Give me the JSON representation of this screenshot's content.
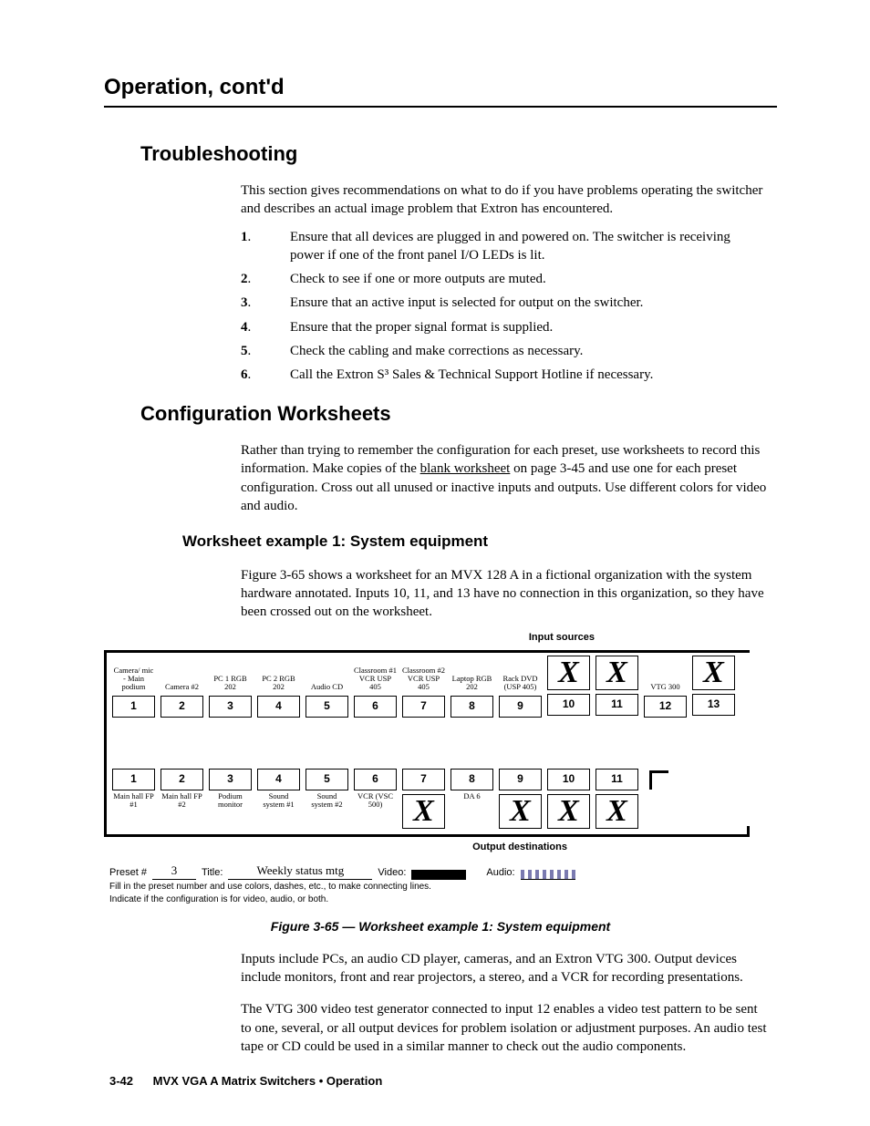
{
  "running_head": "Operation, cont'd",
  "sections": {
    "troubleshooting": {
      "title": "Troubleshooting",
      "intro": "This section gives recommendations on what to do if you have problems operating the switcher and describes an actual image problem that Extron has encountered.",
      "steps": [
        "Ensure that all devices are plugged in and powered on.  The switcher is receiving power if one of the front panel I/O LEDs is lit.",
        "Check to see if one or more outputs are muted.",
        "Ensure that an active input is selected for output on the switcher.",
        "Ensure that the proper signal format is supplied.",
        "Check the cabling and make corrections as necessary.",
        "Call the Extron S³ Sales & Technical Support Hotline if necessary."
      ]
    },
    "worksheets": {
      "title": "Configuration Worksheets",
      "intro_a": "Rather than trying to remember the configuration for each preset, use worksheets to record this information.  Make copies of the ",
      "intro_link": "blank worksheet",
      "intro_b": " on page 3-45 and use one for each preset configuration.  Cross out all unused or inactive inputs and outputs.  Use different colors for video and audio.",
      "example1": {
        "heading": "Worksheet example 1: System equipment",
        "p1": "Figure 3-65 shows a worksheet for an MVX 128 A in a fictional organization with the system hardware annotated.  Inputs 10, 11, and 13 have no connection in this organization, so they have been crossed out on the worksheet.",
        "figure": {
          "input_label": "Input sources",
          "output_label": "Output destinations",
          "inputs": [
            {
              "n": "1",
              "label": "Camera/ mic - Main podium",
              "x": false
            },
            {
              "n": "2",
              "label": "Camera #2",
              "x": false
            },
            {
              "n": "3",
              "label": "PC 1 RGB 202",
              "x": false
            },
            {
              "n": "4",
              "label": "PC 2 RGB 202",
              "x": false
            },
            {
              "n": "5",
              "label": "Audio CD",
              "x": false
            },
            {
              "n": "6",
              "label": "Classroom #1 VCR USP 405",
              "x": false
            },
            {
              "n": "7",
              "label": "Classroom #2 VCR USP 405",
              "x": false
            },
            {
              "n": "8",
              "label": "Laptop RGB 202",
              "x": false
            },
            {
              "n": "9",
              "label": "Rack DVD (USP 405)",
              "x": false
            },
            {
              "n": "10",
              "label": "",
              "x": true
            },
            {
              "n": "11",
              "label": "",
              "x": true
            },
            {
              "n": "12",
              "label": "VTG 300",
              "x": false
            },
            {
              "n": "13",
              "label": "",
              "x": true
            }
          ],
          "outputs": [
            {
              "n": "1",
              "label": "Main hall FP #1",
              "x": false
            },
            {
              "n": "2",
              "label": "Main hall FP #2",
              "x": false
            },
            {
              "n": "3",
              "label": "Podium monitor",
              "x": false
            },
            {
              "n": "4",
              "label": "Sound system #1",
              "x": false
            },
            {
              "n": "5",
              "label": "Sound system #2",
              "x": false
            },
            {
              "n": "6",
              "label": "VCR (VSC 500)",
              "x": false
            },
            {
              "n": "7",
              "label": "",
              "x": true
            },
            {
              "n": "8",
              "label": "DA 6",
              "x": false
            },
            {
              "n": "9",
              "label": "",
              "x": true
            },
            {
              "n": "10",
              "label": "",
              "x": true
            },
            {
              "n": "11",
              "label": "",
              "x": true
            }
          ],
          "legend": {
            "preset_label": "Preset #",
            "preset_value": "3",
            "title_label": "Title:",
            "title_value": "Weekly status mtg",
            "video_label": "Video:",
            "audio_label": "Audio:",
            "note1": "Fill in the preset number and use colors, dashes, etc., to make connecting lines.",
            "note2": "Indicate if the configuration is for video, audio, or both."
          },
          "caption": "Figure 3-65 — Worksheet example 1: System equipment"
        },
        "p2": "Inputs include PCs, an audio CD player, cameras, and an Extron VTG 300.  Output devices include monitors, front and rear projectors, a stereo, and a VCR for recording presentations.",
        "p3": "The VTG 300 video test generator connected to input 12 enables a video test pattern to be sent to one, several, or all output devices for problem isolation or adjustment purposes.  An audio test tape or CD could be used in a similar manner to check out the audio components."
      }
    }
  },
  "footer": {
    "page": "3-42",
    "title": "MVX VGA A Matrix Switchers • Operation"
  }
}
